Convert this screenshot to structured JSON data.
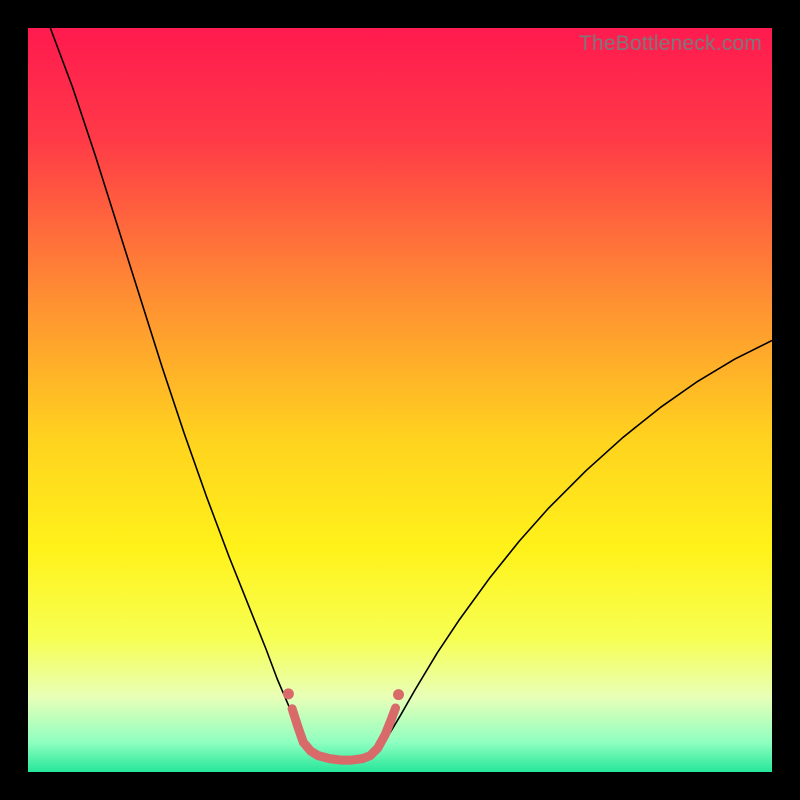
{
  "watermark": "TheBottleneck.com",
  "chart_data": {
    "type": "line",
    "title": "",
    "xlabel": "",
    "ylabel": "",
    "xlim": [
      0,
      100
    ],
    "ylim": [
      0,
      100
    ],
    "background_gradient": {
      "stops": [
        {
          "offset": 0,
          "color": "#ff1a4f"
        },
        {
          "offset": 15,
          "color": "#ff3a47"
        },
        {
          "offset": 35,
          "color": "#ff8a34"
        },
        {
          "offset": 55,
          "color": "#ffd21f"
        },
        {
          "offset": 70,
          "color": "#fff21a"
        },
        {
          "offset": 82,
          "color": "#f7ff52"
        },
        {
          "offset": 90,
          "color": "#e8ffb8"
        },
        {
          "offset": 96,
          "color": "#8effc0"
        },
        {
          "offset": 100,
          "color": "#26e79a"
        }
      ]
    },
    "series": [
      {
        "name": "left-curve",
        "color": "#000000",
        "width": 1.6,
        "points": [
          {
            "x": 3.0,
            "y": 100.0
          },
          {
            "x": 6.0,
            "y": 92.0
          },
          {
            "x": 9.0,
            "y": 83.0
          },
          {
            "x": 12.0,
            "y": 73.5
          },
          {
            "x": 15.0,
            "y": 64.0
          },
          {
            "x": 18.0,
            "y": 54.5
          },
          {
            "x": 21.0,
            "y": 45.5
          },
          {
            "x": 24.0,
            "y": 37.0
          },
          {
            "x": 27.0,
            "y": 29.0
          },
          {
            "x": 30.0,
            "y": 21.5
          },
          {
            "x": 32.0,
            "y": 16.5
          },
          {
            "x": 33.5,
            "y": 12.5
          },
          {
            "x": 35.0,
            "y": 9.0
          },
          {
            "x": 36.0,
            "y": 6.5
          },
          {
            "x": 37.0,
            "y": 4.5
          },
          {
            "x": 38.0,
            "y": 3.0
          }
        ]
      },
      {
        "name": "right-curve",
        "color": "#000000",
        "width": 1.6,
        "points": [
          {
            "x": 47.0,
            "y": 3.0
          },
          {
            "x": 48.5,
            "y": 5.0
          },
          {
            "x": 50.0,
            "y": 7.5
          },
          {
            "x": 52.0,
            "y": 11.0
          },
          {
            "x": 55.0,
            "y": 16.0
          },
          {
            "x": 58.0,
            "y": 20.5
          },
          {
            "x": 62.0,
            "y": 26.0
          },
          {
            "x": 66.0,
            "y": 31.0
          },
          {
            "x": 70.0,
            "y": 35.5
          },
          {
            "x": 75.0,
            "y": 40.5
          },
          {
            "x": 80.0,
            "y": 45.0
          },
          {
            "x": 85.0,
            "y": 49.0
          },
          {
            "x": 90.0,
            "y": 52.5
          },
          {
            "x": 95.0,
            "y": 55.5
          },
          {
            "x": 100.0,
            "y": 58.0
          }
        ]
      },
      {
        "name": "bottom-marker-band",
        "color": "#d86a6a",
        "width": 9,
        "linecap": "round",
        "points": [
          {
            "x": 35.5,
            "y": 8.5
          },
          {
            "x": 36.3,
            "y": 6.0
          },
          {
            "x": 37.0,
            "y": 4.0
          },
          {
            "x": 38.0,
            "y": 2.8
          },
          {
            "x": 39.0,
            "y": 2.2
          },
          {
            "x": 40.5,
            "y": 1.8
          },
          {
            "x": 42.0,
            "y": 1.6
          },
          {
            "x": 43.5,
            "y": 1.6
          },
          {
            "x": 45.0,
            "y": 1.8
          },
          {
            "x": 46.0,
            "y": 2.2
          },
          {
            "x": 47.0,
            "y": 3.2
          },
          {
            "x": 48.0,
            "y": 5.0
          },
          {
            "x": 48.8,
            "y": 7.0
          },
          {
            "x": 49.4,
            "y": 8.6
          }
        ]
      },
      {
        "name": "bottom-marker-dot-left",
        "color": "#d86a6a",
        "type_hint": "dot",
        "r": 5.5,
        "points": [
          {
            "x": 35.0,
            "y": 10.5
          }
        ]
      },
      {
        "name": "bottom-marker-dot-right",
        "color": "#d86a6a",
        "type_hint": "dot",
        "r": 5.5,
        "points": [
          {
            "x": 49.8,
            "y": 10.4
          }
        ]
      }
    ]
  }
}
